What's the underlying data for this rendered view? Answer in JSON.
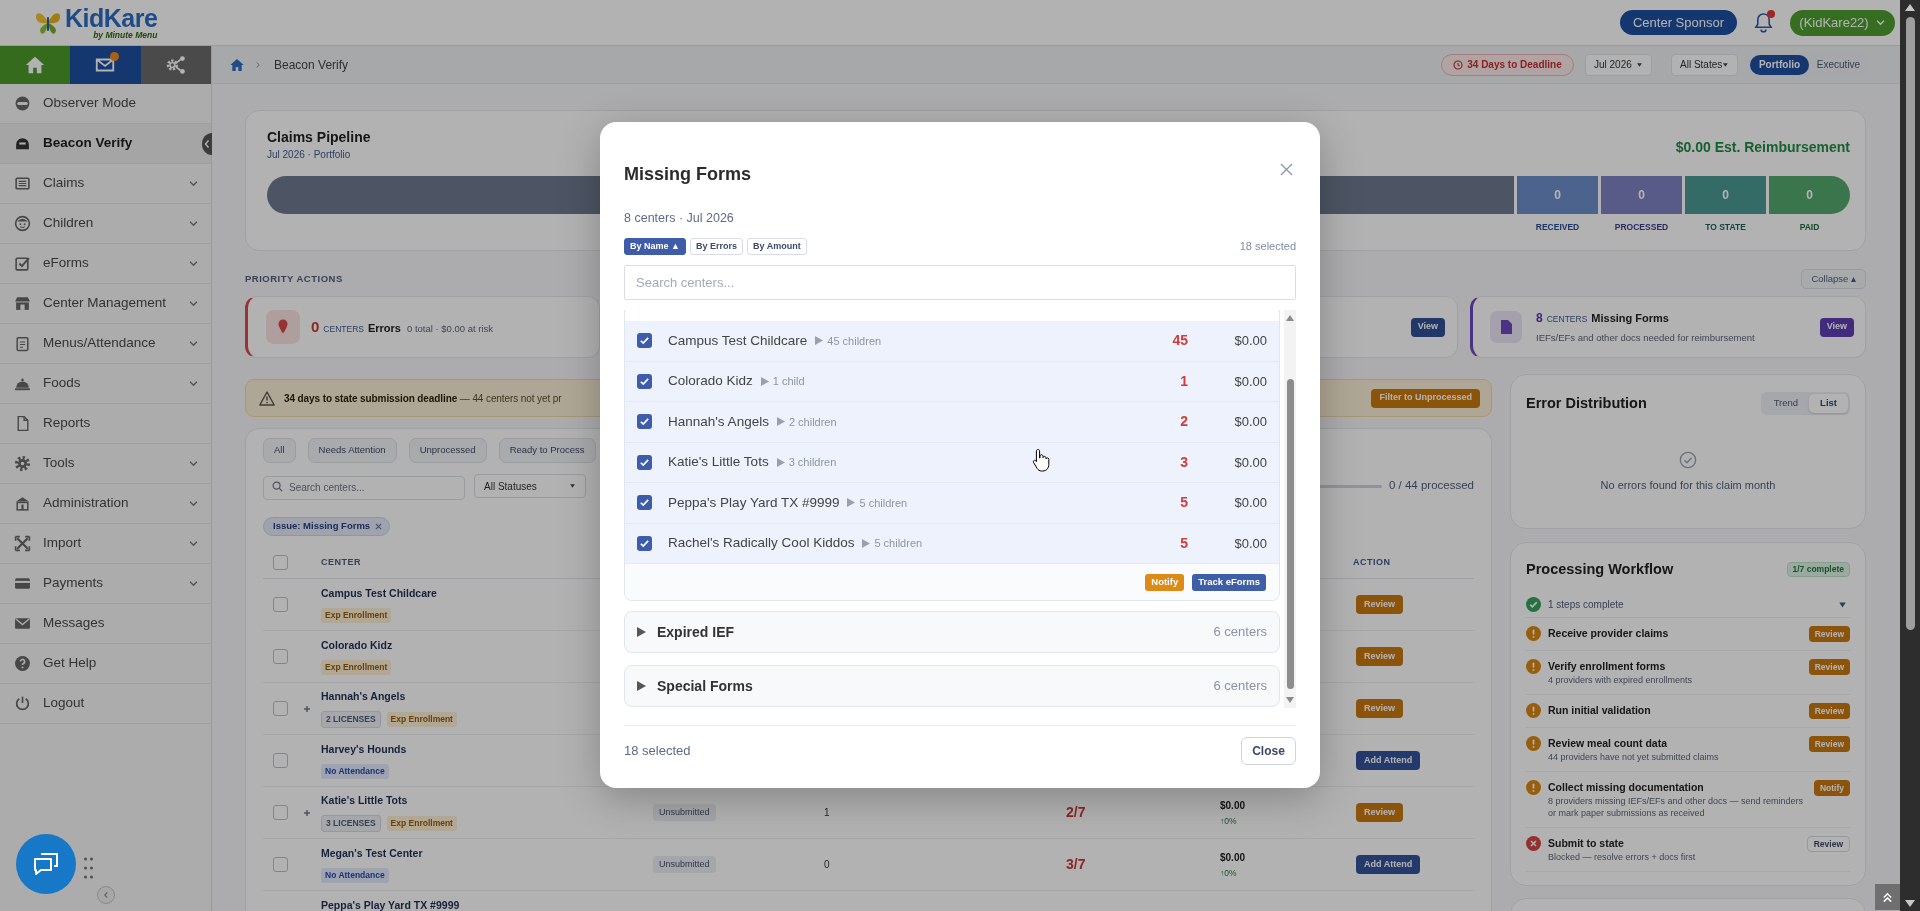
{
  "header": {
    "logo": {
      "wordmark": "KidKare",
      "tagline": "by Minute Menu"
    },
    "role_button": "Center Sponsor",
    "notifications": {
      "unread": true
    },
    "account_menu": "(KidKare22)"
  },
  "sidebar": {
    "quick_tabs": [
      {
        "badge": false
      },
      {
        "badge": true
      },
      {
        "badge": false
      }
    ],
    "items": [
      {
        "label": "Observer Mode",
        "selected": false,
        "has_submenu": false
      },
      {
        "label": "Beacon Verify",
        "selected": true,
        "has_submenu": false
      },
      {
        "label": "Claims",
        "selected": false,
        "has_submenu": true
      },
      {
        "label": "Children",
        "selected": false,
        "has_submenu": true
      },
      {
        "label": "eForms",
        "selected": false,
        "has_submenu": true
      },
      {
        "label": "Center Management",
        "selected": false,
        "has_submenu": true
      },
      {
        "label": "Menus/Attendance",
        "selected": false,
        "has_submenu": true
      },
      {
        "label": "Foods",
        "selected": false,
        "has_submenu": true
      },
      {
        "label": "Reports",
        "selected": false,
        "has_submenu": false
      },
      {
        "label": "Tools",
        "selected": false,
        "has_submenu": true
      },
      {
        "label": "Administration",
        "selected": false,
        "has_submenu": true
      },
      {
        "label": "Import",
        "selected": false,
        "has_submenu": true
      },
      {
        "label": "Payments",
        "selected": false,
        "has_submenu": true
      },
      {
        "label": "Messages",
        "selected": false,
        "has_submenu": false
      },
      {
        "label": "Get Help",
        "selected": false,
        "has_submenu": false
      },
      {
        "label": "Logout",
        "selected": false,
        "has_submenu": false
      }
    ]
  },
  "breadcrumb": {
    "current": "Beacon Verify"
  },
  "toolbar": {
    "deadline_badge": "34 Days to Deadline",
    "month_select": "Jul 2026",
    "state_select": "All States",
    "view_toggle": [
      {
        "label": "Portfolio",
        "selected": true
      },
      {
        "label": "Executive",
        "selected": false
      }
    ]
  },
  "pipeline": {
    "title": "Claims Pipeline",
    "subtitle": "Jul 2026 · Portfolio",
    "estimate": "$0.00 Est. Reimbursement",
    "stages": [
      {
        "label": "RECEIVED",
        "count": "0"
      },
      {
        "label": "PROCESSED",
        "count": "0"
      },
      {
        "label": "TO STATE",
        "count": "0"
      },
      {
        "label": "PAID",
        "count": "0"
      }
    ]
  },
  "priority": {
    "heading": "PRIORITY ACTIONS",
    "collapse_button": "Collapse ▴",
    "cards": [
      {
        "kind": "error",
        "count": "0",
        "unit": "CENTERS",
        "title": "Errors",
        "detail": "0 total · $0.00 at risk"
      },
      {
        "kind": "info",
        "button": "View"
      },
      {
        "kind": "forms",
        "count": "8",
        "unit": "CENTERS",
        "title": "Missing Forms",
        "detail": "IEFs/EFs and other docs needed for reimbursement",
        "button": "View"
      }
    ]
  },
  "deadline_banner": {
    "message": "**34 days to state submission deadline** — 44 centers not yet pr",
    "button": "Filter to Unprocessed"
  },
  "table": {
    "tabs": [
      {
        "label": "All",
        "selected": false
      },
      {
        "label": "Needs Attention",
        "selected": false
      },
      {
        "label": "Unprocessed",
        "selected": false
      },
      {
        "label": "Ready to Process",
        "selected": false
      }
    ],
    "search": {
      "placeholder": "Search centers..."
    },
    "status_filter": "All Statuses",
    "progress": {
      "label": "0 / 44 processed"
    },
    "filter_chip": "Issue: Missing Forms",
    "select_all": {
      "checked": false
    },
    "columns": {
      "center": "CENTER",
      "action": "ACTION"
    },
    "rows": [
      {
        "name": "Campus Test Childcare",
        "checked": false,
        "expandable": false,
        "tags": [
          {
            "label": "Exp Enrollment",
            "kind": "warning"
          }
        ],
        "action": {
          "label": "Review",
          "kind": "warning"
        }
      },
      {
        "name": "Colorado Kidz",
        "checked": false,
        "expandable": false,
        "tags": [
          {
            "label": "Exp Enrollment",
            "kind": "warning"
          }
        ],
        "action": {
          "label": "Review",
          "kind": "warning"
        }
      },
      {
        "name": "Hannah's Angels",
        "checked": false,
        "expandable": true,
        "tags": [
          {
            "label": "2 LICENSES",
            "kind": "neutral"
          },
          {
            "label": "Exp Enrollment",
            "kind": "warning"
          }
        ],
        "action": {
          "label": "Review",
          "kind": "warning"
        }
      },
      {
        "name": "Harvey's Hounds",
        "checked": false,
        "expandable": false,
        "tags": [
          {
            "label": "No Attendance",
            "kind": "info"
          }
        ],
        "action": {
          "label": "Add Attend",
          "kind": "primary"
        }
      },
      {
        "name": "Katie's Little Tots",
        "checked": false,
        "expandable": true,
        "tags": [
          {
            "label": "3 LICENSES",
            "kind": "neutral"
          },
          {
            "label": "Exp Enrollment",
            "kind": "warning"
          }
        ],
        "status": "Unsubmitted",
        "count": "1",
        "ratio": "2/7",
        "amount": "$0.00",
        "change": "↑0%",
        "action": {
          "label": "Review",
          "kind": "warning"
        }
      },
      {
        "name": "Megan's Test Center",
        "checked": false,
        "expandable": false,
        "tags": [
          {
            "label": "No Attendance",
            "kind": "info"
          }
        ],
        "status": "Unsubmitted",
        "count": "0",
        "ratio": "3/7",
        "amount": "$0.00",
        "change": "↑0%",
        "action": {
          "label": "Add Attend",
          "kind": "primary"
        }
      },
      {
        "name": "Peppa's Play Yard TX #9999"
      }
    ]
  },
  "error_distribution": {
    "title": "Error Distribution",
    "views": [
      {
        "label": "Trend",
        "selected": false
      },
      {
        "label": "List",
        "selected": true
      }
    ],
    "empty_message": "No errors found for this claim month"
  },
  "workflow": {
    "title": "Processing Workflow",
    "badge": "1/7 complete",
    "summary": {
      "label": "1 steps complete",
      "expanded": false
    },
    "steps": [
      {
        "title": "Receive provider claims",
        "kind": "pending",
        "button": "Review"
      },
      {
        "title": "Verify enrollment forms",
        "detail": "4 providers with expired enrollments",
        "kind": "pending",
        "button": "Review"
      },
      {
        "title": "Run initial validation",
        "kind": "pending",
        "button": "Review"
      },
      {
        "title": "Review meal count data",
        "detail": "44 providers have not yet submitted claims",
        "kind": "pending",
        "button": "Review"
      },
      {
        "title": "Collect missing documentation",
        "detail": "8 providers missing IEFs/EFs and other docs — send reminders or mark paper submissions as received",
        "kind": "pending",
        "button": "Notify"
      },
      {
        "title": "Submit to state",
        "detail": "Blocked — resolve errors + docs first",
        "kind": "blocked",
        "button": "Review"
      }
    ]
  },
  "modal": {
    "title": "Missing Forms",
    "subtitle": "8 centers · Jul 2026",
    "sort_buttons": [
      {
        "label": "By Name ▲",
        "selected": true
      },
      {
        "label": "By Errors",
        "selected": false
      },
      {
        "label": "By Amount",
        "selected": false
      }
    ],
    "selection_count": "18 selected",
    "search": {
      "placeholder": "Search centers..."
    },
    "groups": [
      {
        "expanded": true,
        "rows": [
          {
            "name": "Campus Test Childcare",
            "child_count": "45 children",
            "errors": "45",
            "amount": "$0.00",
            "checked": true
          },
          {
            "name": "Colorado Kidz",
            "child_count": "1 child",
            "errors": "1",
            "amount": "$0.00",
            "checked": true
          },
          {
            "name": "Hannah's Angels",
            "child_count": "2 children",
            "errors": "2",
            "amount": "$0.00",
            "checked": true
          },
          {
            "name": "Katie's Little Tots",
            "child_count": "3 children",
            "errors": "3",
            "amount": "$0.00",
            "checked": true
          },
          {
            "name": "Peppa's Play Yard TX #9999",
            "child_count": "5 children",
            "errors": "5",
            "amount": "$0.00",
            "checked": true
          },
          {
            "name": "Rachel's Radically Cool Kiddos",
            "child_count": "5 children",
            "errors": "5",
            "amount": "$0.00",
            "checked": true
          }
        ],
        "actions": [
          {
            "label": "Notify",
            "kind": "warning"
          },
          {
            "label": "Track eForms",
            "kind": "primary"
          }
        ]
      },
      {
        "title": "Expired IEF",
        "count": "6 centers",
        "expanded": false
      },
      {
        "title": "Special Forms",
        "count": "6 centers",
        "expanded": false
      }
    ],
    "footer": {
      "selection_count": "18 selected",
      "close_button": "Close"
    }
  }
}
